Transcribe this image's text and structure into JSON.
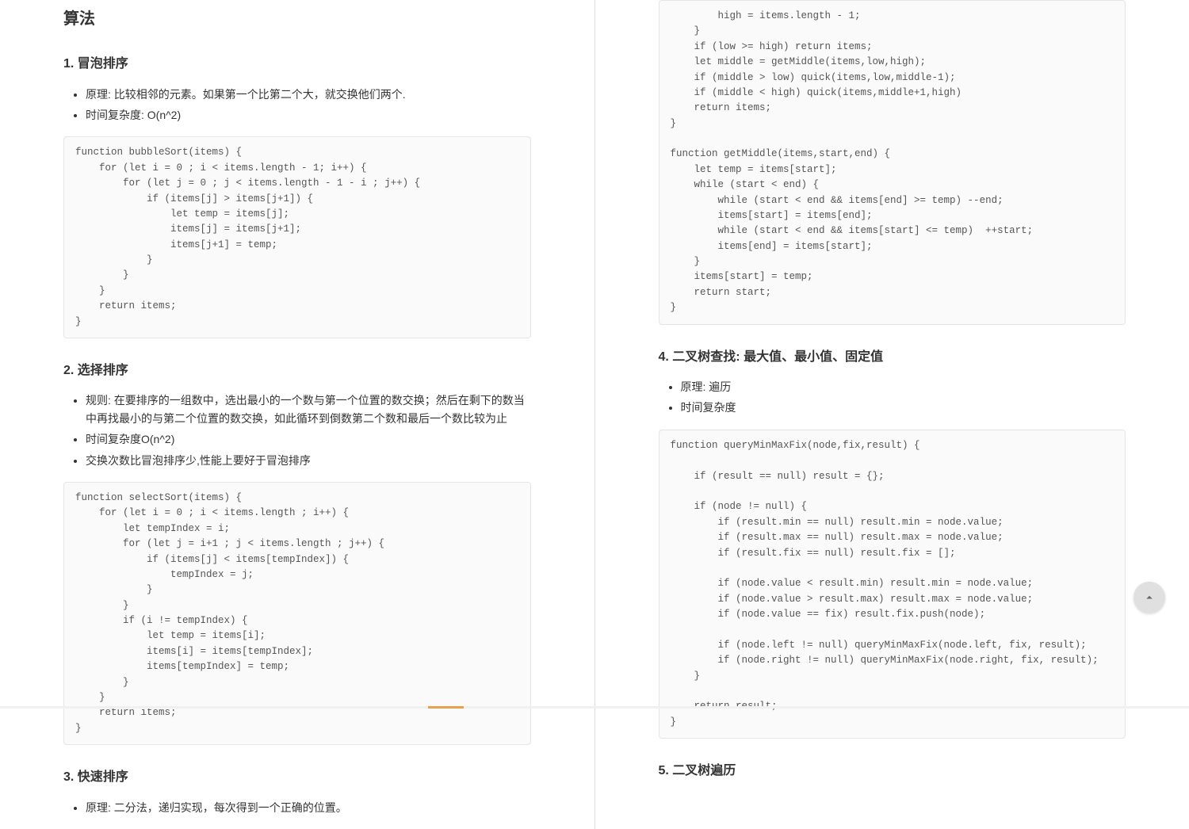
{
  "left": {
    "title": "算法",
    "section1": {
      "heading": "1. 冒泡排序",
      "bullets": [
        "原理: 比较相邻的元素。如果第一个比第二个大，就交换他们两个.",
        "时间复杂度: O(n^2)"
      ],
      "code": "function bubbleSort(items) {\n    for (let i = 0 ; i < items.length - 1; i++) {\n        for (let j = 0 ; j < items.length - 1 - i ; j++) {\n            if (items[j] > items[j+1]) {\n                let temp = items[j];\n                items[j] = items[j+1];\n                items[j+1] = temp;\n            }\n        }\n    }\n    return items;\n}"
    },
    "section2": {
      "heading": "2. 选择排序",
      "bullets": [
        "规则: 在要排序的一组数中，选出最小的一个数与第一个位置的数交换；然后在剩下的数当中再找最小的与第二个位置的数交换，如此循环到倒数第二个数和最后一个数比较为止",
        "时间复杂度O(n^2)",
        "交换次数比冒泡排序少,性能上要好于冒泡排序"
      ],
      "code": "function selectSort(items) {\n    for (let i = 0 ; i < items.length ; i++) {\n        let tempIndex = i;\n        for (let j = i+1 ; j < items.length ; j++) {\n            if (items[j] < items[tempIndex]) {\n                tempIndex = j;\n            }\n        }\n        if (i != tempIndex) {\n            let temp = items[i];\n            items[i] = items[tempIndex];\n            items[tempIndex] = temp;\n        }\n    }\n    return items;\n}"
    },
    "section3": {
      "heading": "3. 快速排序",
      "bullets": [
        "原理: 二分法，递归实现，每次得到一个正确的位置。"
      ]
    }
  },
  "right": {
    "topCode": "        high = items.length - 1;\n    }\n    if (low >= high) return items;\n    let middle = getMiddle(items,low,high);\n    if (middle > low) quick(items,low,middle-1);\n    if (middle < high) quick(items,middle+1,high)\n    return items;\n}\n\nfunction getMiddle(items,start,end) {\n    let temp = items[start];\n    while (start < end) {\n        while (start < end && items[end] >= temp) --end;\n        items[start] = items[end];\n        while (start < end && items[start] <= temp)  ++start;\n        items[end] = items[start];\n    }\n    items[start] = temp;\n    return start;\n}",
    "section4": {
      "heading": "4. 二叉树查找: 最大值、最小值、固定值",
      "bullets": [
        "原理: 遍历",
        "时间复杂度"
      ],
      "code": "function queryMinMaxFix(node,fix,result) {\n\n    if (result == null) result = {};\n\n    if (node != null) {\n        if (result.min == null) result.min = node.value;\n        if (result.max == null) result.max = node.value;\n        if (result.fix == null) result.fix = [];\n\n        if (node.value < result.min) result.min = node.value;\n        if (node.value > result.max) result.max = node.value;\n        if (node.value == fix) result.fix.push(node);\n\n        if (node.left != null) queryMinMaxFix(node.left, fix, result);\n        if (node.right != null) queryMinMaxFix(node.right, fix, result);\n    }\n\n    return result;\n}"
    },
    "section5": {
      "heading": "5. 二叉树遍历"
    }
  }
}
